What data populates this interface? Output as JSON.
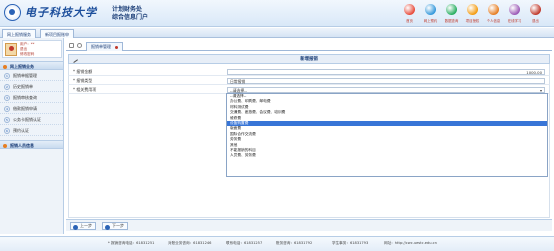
{
  "header": {
    "logo_text": "电子科技大学",
    "title_line1": "计划财务处",
    "title_line2": "综合信息门户",
    "nav": [
      {
        "label": "首页",
        "icon": "home-icon",
        "color": "#e74c3c"
      },
      {
        "label": "网上预约",
        "icon": "calendar-icon",
        "color": "#3498db"
      },
      {
        "label": "数据查询",
        "icon": "search-icon",
        "color": "#27ae60"
      },
      {
        "label": "项目授权",
        "icon": "key-icon",
        "color": "#f39c12"
      },
      {
        "label": "个人信息",
        "icon": "user-icon",
        "color": "#e67e22"
      },
      {
        "label": "在线学习",
        "icon": "book-icon",
        "color": "#9b59b6"
      },
      {
        "label": "退出",
        "icon": "power-icon",
        "color": "#c0392b"
      }
    ]
  },
  "side_tabs": [
    "网上报销服务",
    "新项目报账申"
  ],
  "user": {
    "line1": "用户：**",
    "line2": "退出",
    "line3": "修改密码"
  },
  "menu": {
    "section1": "网上报销业务",
    "items": [
      {
        "num": "1",
        "label": "报销单据管理"
      },
      {
        "num": "2",
        "label": "历史报销单"
      },
      {
        "num": "3",
        "label": "报销审核查询"
      },
      {
        "num": "4",
        "label": "借款报销申请"
      },
      {
        "num": "5",
        "label": "公务卡报销认证"
      },
      {
        "num": "6",
        "label": "预约认证"
      }
    ],
    "section2": "报销人员信息"
  },
  "main_tab": "报销单管理",
  "form": {
    "header": "新增报销",
    "rows": [
      {
        "label": "* 报销金额",
        "value": "1000.00",
        "type": "amount"
      },
      {
        "label": "* 报销类型",
        "value": "日常报销",
        "type": "text"
      },
      {
        "label": "* 相关费用项",
        "value": "--请选择--",
        "type": "select"
      }
    ]
  },
  "dropdown": {
    "options": [
      "--请选择--",
      "办公费、印刷费、邮电费",
      "材料测试费",
      "交通费、差旅费、会议费、培训费",
      "维修费",
      "设备购置费",
      "版面费",
      "国际合作交流费",
      "劳务费",
      "其他",
      "不能报销的科目",
      "人员费、劳务费"
    ],
    "selected_index": 5
  },
  "pager": {
    "prev": "上一步",
    "next": "下一步"
  },
  "footer": {
    "item1": "* 报销咨询电话：61831251",
    "item2": "对账业务咨询：61831246",
    "item3": "联系电话：61831257",
    "item4": "账务咨询：61831792",
    "item5": "学生事务：61831793",
    "item6": "网址：http://cwc.uestc.edu.cn"
  }
}
